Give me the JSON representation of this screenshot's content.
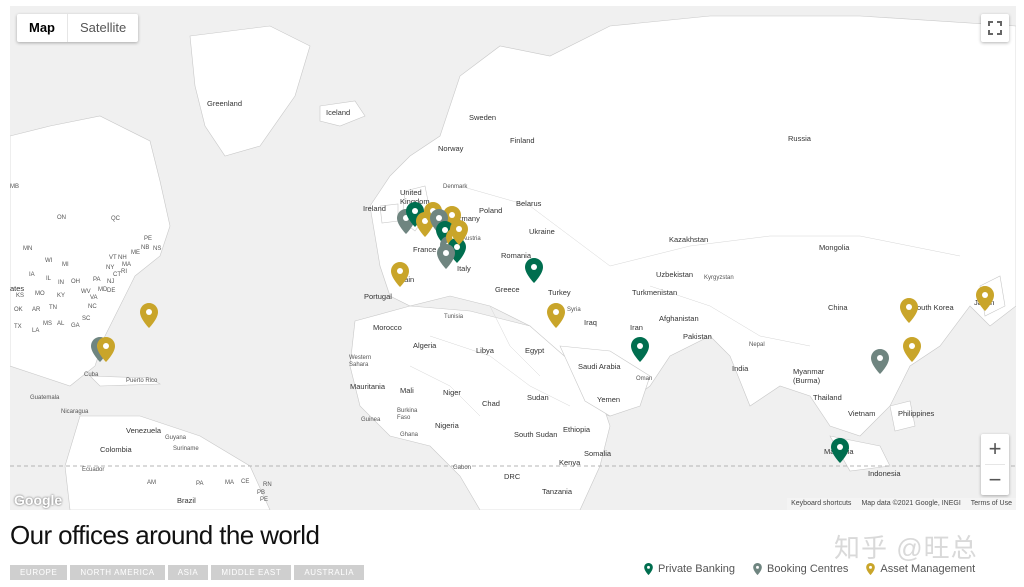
{
  "map": {
    "type_controls": {
      "map": "Map",
      "satellite": "Satellite"
    },
    "labels": {
      "greenland": "Greenland",
      "iceland": "Iceland",
      "sweden": "Sweden",
      "finland": "Finland",
      "russia": "Russia",
      "norway": "Norway",
      "denmark": "Denmark",
      "uk": "United Kingdom",
      "ireland": "Ireland",
      "belarus": "Belarus",
      "poland": "Poland",
      "ukraine": "Ukraine",
      "germany": "Germany",
      "france": "France",
      "austria": "Austria",
      "romania": "Romania",
      "italy": "Italy",
      "spain": "Spain",
      "portugal": "Portugal",
      "greece": "Greece",
      "turkey": "Turkey",
      "kazakhstan": "Kazakhstan",
      "mongolia": "Mongolia",
      "uzbekistan": "Uzbekistan",
      "kyrgyzstan": "Kyrgyzstan",
      "turkmenistan": "Turkmenistan",
      "afghanistan": "Afghanistan",
      "china": "China",
      "south_korea": "South Korea",
      "japan": "Japan",
      "iran": "Iran",
      "iraq": "Iraq",
      "syria": "Syria",
      "pakistan": "Pakistan",
      "nepal": "Nepal",
      "india": "India",
      "myanmar": "Myanmar (Burma)",
      "thailand": "Thailand",
      "vietnam": "Vietnam",
      "philippines": "Philippines",
      "malaysia": "Malaysia",
      "indonesia": "Indonesia",
      "tunisia": "Tunisia",
      "morocco": "Morocco",
      "algeria": "Algeria",
      "libya": "Libya",
      "egypt": "Egypt",
      "saudi_arabia": "Saudi Arabia",
      "oman": "Oman",
      "yemen": "Yemen",
      "western_sahara": "Western Sahara",
      "mauritania": "Mauritania",
      "mali": "Mali",
      "niger": "Niger",
      "chad": "Chad",
      "sudan": "Sudan",
      "burkina_faso": "Burkina Faso",
      "guinea": "Guinea",
      "ghana": "Ghana",
      "nigeria": "Nigeria",
      "south_sudan": "South Sudan",
      "ethiopia": "Ethiopia",
      "somalia": "Somalia",
      "kenya": "Kenya",
      "gabon": "Gabon",
      "drc": "DRC",
      "tanzania": "Tanzania",
      "venezuela": "Venezuela",
      "guyana": "Guyana",
      "suriname": "Suriname",
      "colombia": "Colombia",
      "ecuador": "Ecuador",
      "brazil": "Brazil",
      "guatemala": "Guatemala",
      "nicaragua": "Nicaragua",
      "cuba": "Cuba",
      "puerto_rico": "Puerto Rico",
      "states": "ates",
      "qc": "QC",
      "on": "ON",
      "mb": "MB",
      "nb": "NB",
      "ns": "NS",
      "mn": "MN",
      "wi": "WI",
      "mi": "MI",
      "ia": "IA",
      "il": "IL",
      "in": "IN",
      "oh": "OH",
      "pa": "PA",
      "ny": "NY",
      "va": "VA",
      "ok": "OK",
      "ar": "AR",
      "tn": "TN",
      "nc": "NC",
      "sc": "SC",
      "ms": "MS",
      "al": "AL",
      "ga": "GA",
      "tx": "TX",
      "la": "LA",
      "ks": "KS",
      "mo": "MO",
      "ky": "KY",
      "wv": "WV",
      "nj": "NJ",
      "md": "MD",
      "de": "DE",
      "ct": "CT",
      "ri": "RI",
      "ma": "MA",
      "me": "ME",
      "vt": "VT",
      "nh": "NH",
      "pe": "PE",
      "am": "AM",
      "pa_br": "PA",
      "ma_br": "MA",
      "ce": "CE",
      "rn": "RN",
      "pb": "PB",
      "pe_br": "PE"
    },
    "google_logo": "Google",
    "attribution": {
      "shortcuts": "Keyboard shortcuts",
      "data": "Map data ©2021 Google, INEGI",
      "terms": "Terms of Use"
    },
    "zoom_in": "+",
    "zoom_out": "−",
    "markers": [
      {
        "category": "private_banking"
      },
      {
        "category": "booking_centres"
      },
      {
        "category": "asset_management"
      }
    ]
  },
  "colors": {
    "private_banking": "#006e4f",
    "booking_centres": "#6f8580",
    "asset_management": "#c9a52a"
  },
  "footer": {
    "title": "Our offices around the world",
    "tabs": [
      "EUROPE",
      "NORTH AMERICA",
      "ASIA",
      "MIDDLE EAST",
      "AUSTRALIA"
    ],
    "legend": {
      "private_banking": "Private Banking",
      "booking_centres": "Booking Centres",
      "asset_management": "Asset Management"
    }
  },
  "watermark": "知乎 @旺总"
}
